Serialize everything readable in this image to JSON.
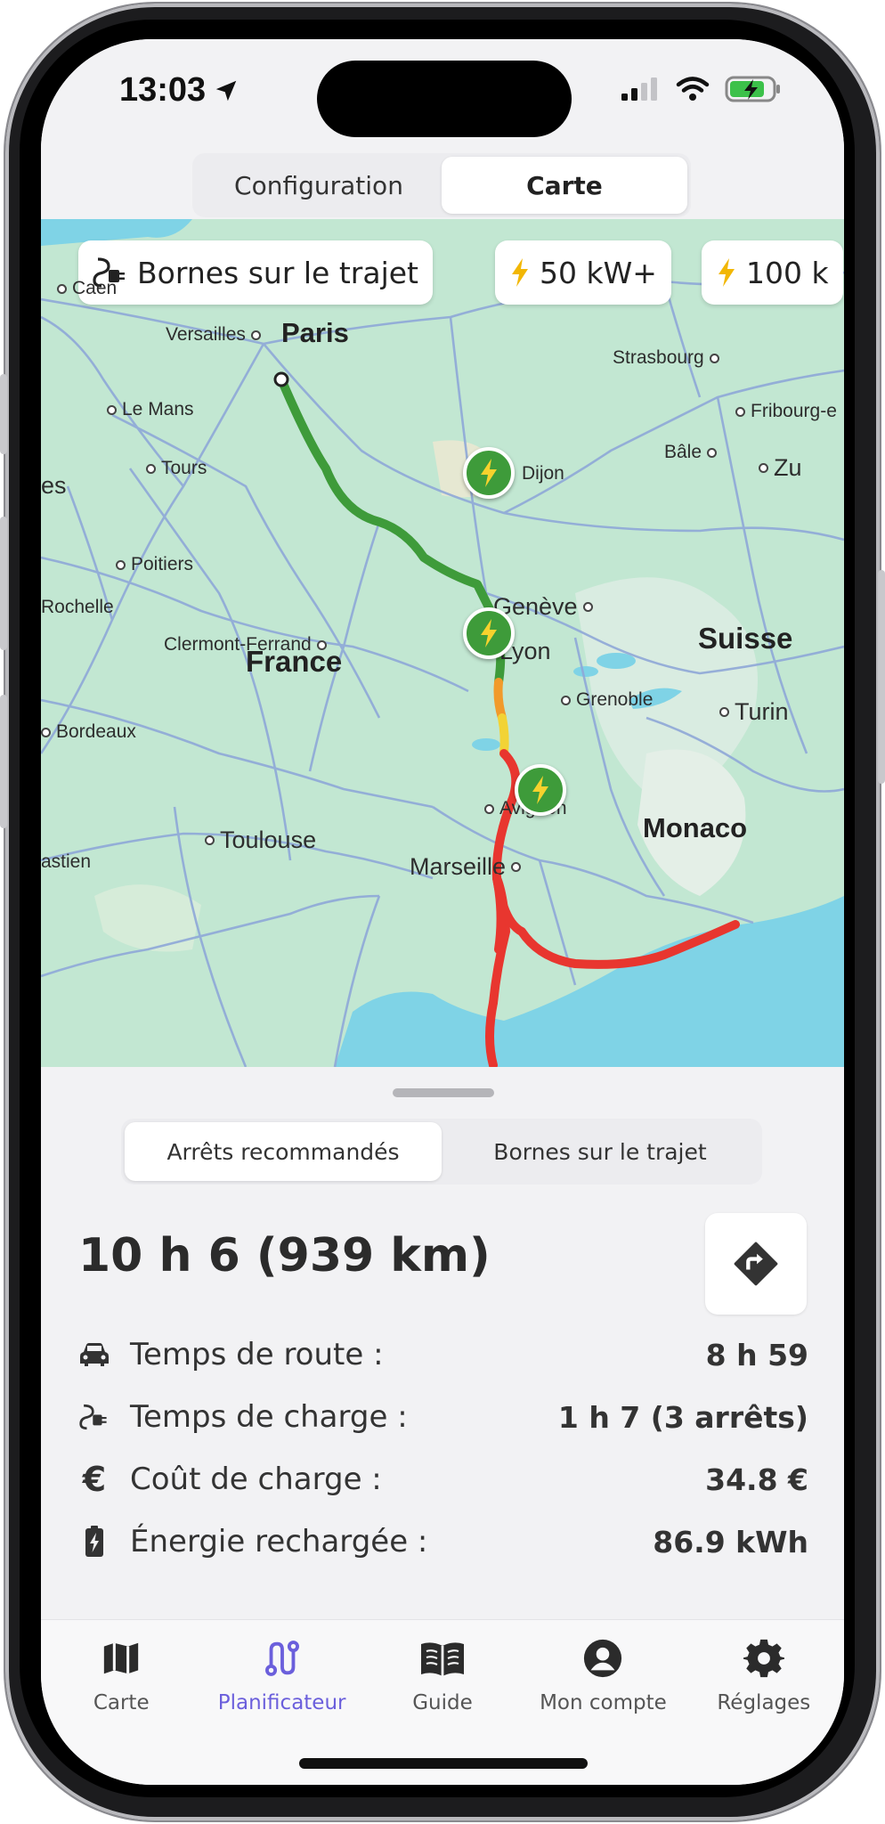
{
  "status_bar": {
    "time": "13:03"
  },
  "top_tabs": [
    {
      "label": "Configuration",
      "active": false
    },
    {
      "label": "Carte",
      "active": true
    }
  ],
  "map": {
    "chips": [
      {
        "label": "Bornes sur le trajet",
        "icon": "ev-plug-icon"
      },
      {
        "label": "50 kW+",
        "icon": "bolt-icon"
      },
      {
        "label": "100 k",
        "icon": "bolt-icon"
      }
    ],
    "country_labels": {
      "france": "France",
      "suisse": "Suisse"
    },
    "cities": {
      "caen": "Caen",
      "paris": "Paris",
      "versailles": "Versailles",
      "strasbourg": "Strasbourg",
      "le_mans": "Le Mans",
      "fribourg": "Fribourg-e",
      "bale": "Bâle",
      "tours": "Tours",
      "dijon": "Dijon",
      "zurich": "Zu",
      "nantes": "es",
      "poitiers": "Poitiers",
      "rochelle": "Rochelle",
      "geneve": "Genève",
      "clermont": "Clermont-Ferrand",
      "lyon": "Lyon",
      "grenoble": "Grenoble",
      "turin": "Turin",
      "bordeaux": "Bordeaux",
      "avignon": "Avignon",
      "monaco": "Monaco",
      "toulouse": "Toulouse",
      "marseille": "Marseille",
      "bastien": "astien"
    },
    "colors": {
      "green": "#3e9b3a",
      "yellow": "#f2d335",
      "orange": "#f19a2b",
      "red": "#e8362f",
      "water": "#7fd3e6"
    }
  },
  "sheet": {
    "tabs": [
      {
        "label": "Arrêts recommandés",
        "active": true
      },
      {
        "label": "Bornes sur le trajet",
        "active": false
      }
    ],
    "summary": "10 h 6 (939 km)",
    "stats": [
      {
        "icon": "car-icon",
        "label": "Temps de route :",
        "value": "8 h 59"
      },
      {
        "icon": "ev-plug-icon",
        "label": "Temps de charge :",
        "value": "1 h 7 (3 arrêts)"
      },
      {
        "icon": "euro-icon",
        "label": "Coût de charge :",
        "value": "34.8 €"
      },
      {
        "icon": "battery-charging-icon",
        "label": "Énergie rechargée :",
        "value": "86.9 kWh"
      }
    ]
  },
  "tabbar": [
    {
      "label": "Carte",
      "icon": "map-icon",
      "active": false
    },
    {
      "label": "Planificateur",
      "icon": "route-icon",
      "active": true
    },
    {
      "label": "Guide",
      "icon": "book-icon",
      "active": false
    },
    {
      "label": "Mon compte",
      "icon": "user-icon",
      "active": false
    },
    {
      "label": "Réglages",
      "icon": "gear-icon",
      "active": false
    }
  ]
}
